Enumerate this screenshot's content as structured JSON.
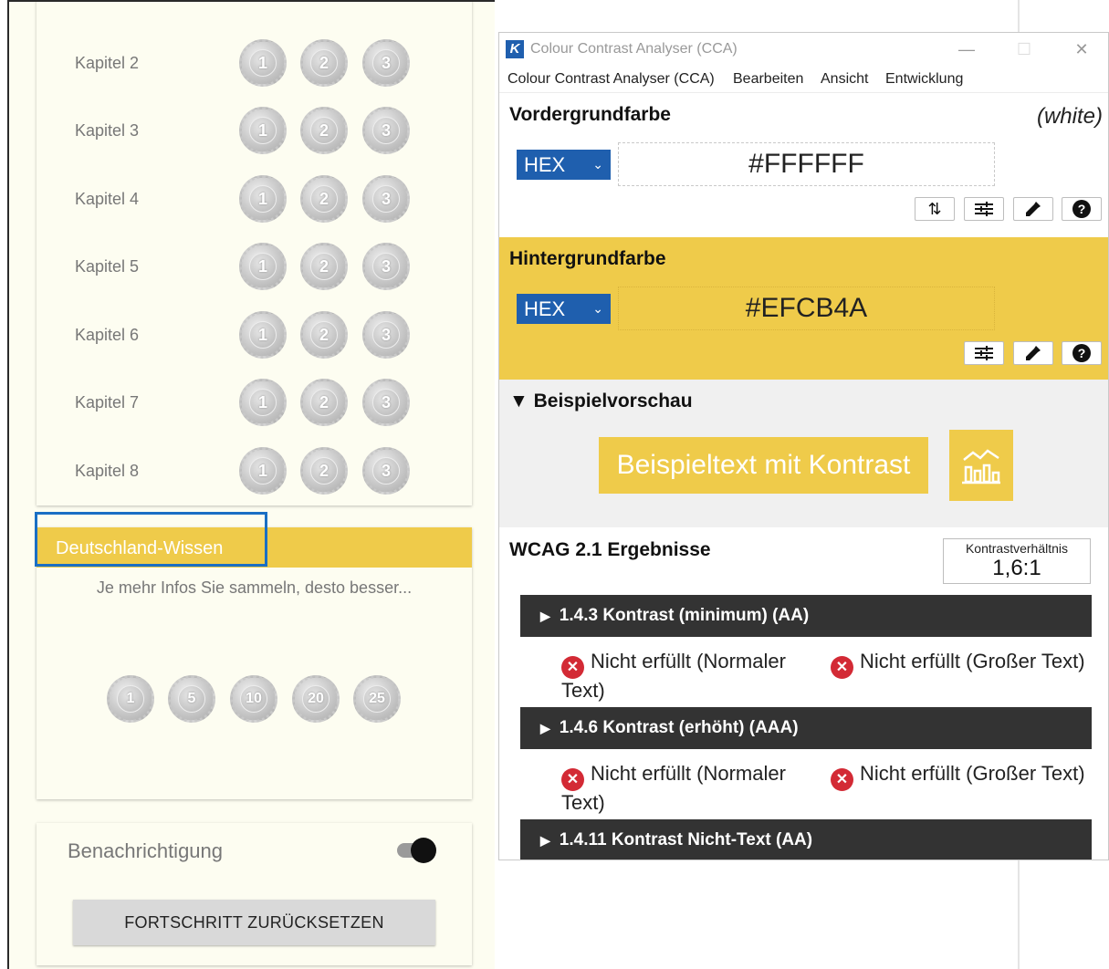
{
  "app": {
    "chapters": [
      {
        "label": "Kapitel 2",
        "medals": [
          "1",
          "2",
          "3"
        ]
      },
      {
        "label": "Kapitel 3",
        "medals": [
          "1",
          "2",
          "3"
        ]
      },
      {
        "label": "Kapitel 4",
        "medals": [
          "1",
          "2",
          "3"
        ]
      },
      {
        "label": "Kapitel 5",
        "medals": [
          "1",
          "2",
          "3"
        ]
      },
      {
        "label": "Kapitel 6",
        "medals": [
          "1",
          "2",
          "3"
        ]
      },
      {
        "label": "Kapitel 7",
        "medals": [
          "1",
          "2",
          "3"
        ]
      },
      {
        "label": "Kapitel 8",
        "medals": [
          "1",
          "2",
          "3"
        ]
      }
    ],
    "wissen": {
      "title": "Deutschland-Wissen",
      "subtitle": "Je mehr Infos Sie sammeln, desto besser...",
      "medals": [
        "1",
        "5",
        "10",
        "20",
        "25"
      ]
    },
    "notification": {
      "label": "Benachrichtigung",
      "enabled": true
    },
    "reset_button": "FORTSCHRITT ZURÜCKSETZEN",
    "colors": {
      "accent": "#efcb4a",
      "background": "#fdfdf1",
      "highlight_border": "#1a6fc4"
    }
  },
  "cca": {
    "window_title": "Colour Contrast Analyser (CCA)",
    "menu": [
      "Colour Contrast Analyser (CCA)",
      "Bearbeiten",
      "Ansicht",
      "Entwicklung"
    ],
    "foreground": {
      "title": "Vordergrundfarbe",
      "name": "(white)",
      "format": "HEX",
      "value": "#FFFFFF",
      "color": "#FFFFFF"
    },
    "background": {
      "title": "Hintergrundfarbe",
      "format": "HEX",
      "value": "#EFCB4A",
      "color": "#EFCB4A"
    },
    "preview": {
      "title": "Beispielvorschau",
      "sample_text": "Beispieltext mit Kontrast"
    },
    "wcag": {
      "title": "WCAG 2.1 Ergebnisse",
      "ratio_label": "Kontrastverhältnis",
      "ratio_value": "1,6:1",
      "criteria": [
        {
          "label": "1.4.3 Kontrast (minimum) (AA)",
          "normal": "Nicht erfüllt (Normaler Text)",
          "large": "Nicht erfüllt (Großer Text)"
        },
        {
          "label": "1.4.6 Kontrast (erhöht) (AAA)",
          "normal": "Nicht erfüllt (Normaler Text)",
          "large": "Nicht erfüllt (Großer Text)"
        },
        {
          "label": "1.4.11 Kontrast Nicht-Text (AA)"
        }
      ]
    },
    "icons": [
      "swap-icon",
      "sliders-icon",
      "eyedropper-icon",
      "help-icon",
      "chart-icon",
      "fail-icon"
    ],
    "colors": {
      "select_blue": "#1f5fae",
      "criteria_bar": "#333333",
      "fail_red": "#d32a35"
    }
  }
}
